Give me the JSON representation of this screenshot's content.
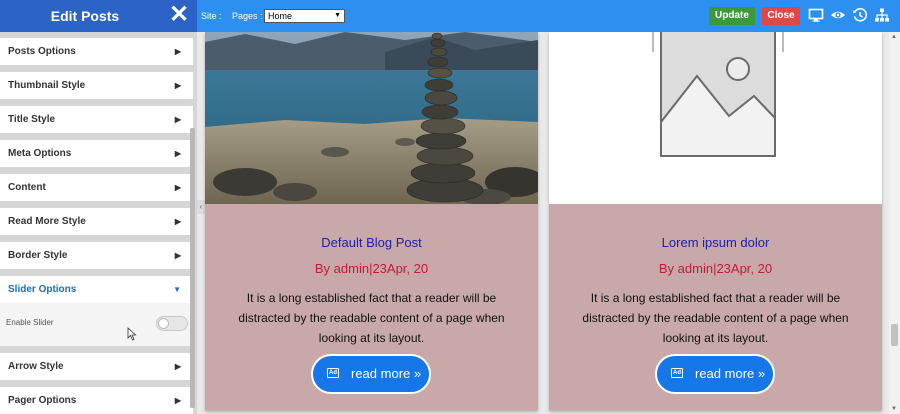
{
  "sidebar": {
    "title": "Edit Posts",
    "items": [
      {
        "label": "Posts Options"
      },
      {
        "label": "Thumbnail Style"
      },
      {
        "label": "Title Style"
      },
      {
        "label": "Meta Options"
      },
      {
        "label": "Content"
      },
      {
        "label": "Read More Style"
      },
      {
        "label": "Border Style"
      },
      {
        "label": "Slider Options",
        "expanded": true
      },
      {
        "label": "Arrow Style"
      },
      {
        "label": "Pager Options"
      }
    ],
    "slider_toggle": {
      "label": "Enable Slider",
      "enabled": false
    }
  },
  "topbar": {
    "site_label": "Site :",
    "pages_label": "Pages :",
    "pages_selected": "Home",
    "update_label": "Update",
    "close_label": "Close",
    "icons": [
      "monitor-icon",
      "eye-icon",
      "history-icon",
      "sitemap-icon"
    ],
    "colors": {
      "bar": "#2d90f0",
      "update": "#3a9a3a",
      "close": "#e04848"
    }
  },
  "posts": [
    {
      "title": "Default Blog Post",
      "meta": "By admin|23Apr, 20",
      "excerpt": "It is a long established fact that a reader will be distracted by the readable content of a page when looking at its layout.",
      "read_more": "read more »",
      "thumbnail": "stacked-stones-lake-photo"
    },
    {
      "title": "Lorem ipsum dolor",
      "meta": "By admin|23Apr, 20",
      "excerpt": "It is a long established fact that a reader will be distracted by the readable content of a page when looking at its layout.",
      "read_more": "read more »",
      "thumbnail": "placeholder-image-icon"
    }
  ]
}
